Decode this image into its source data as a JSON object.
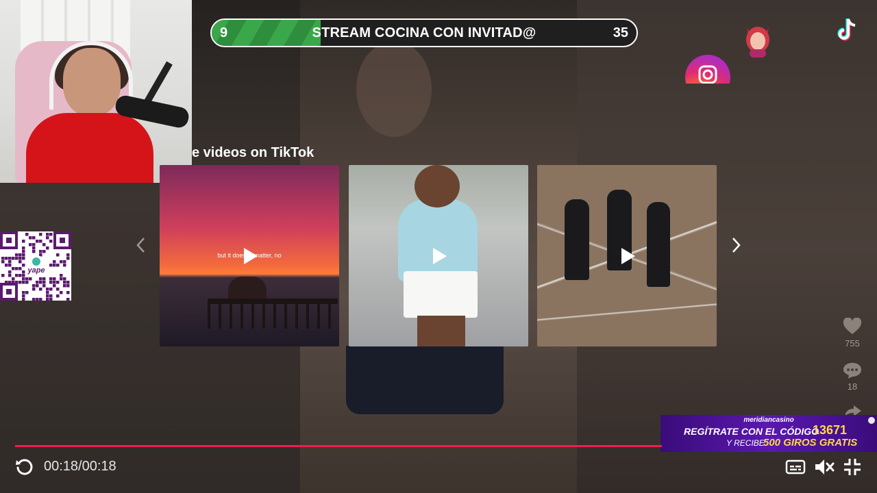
{
  "stream_goal": {
    "current": "9",
    "title": "STREAM COCINA CON INVITAD@",
    "target": "35",
    "progress_fraction": 0.257
  },
  "tiktok_panel": {
    "heading": "e videos on TikTok",
    "videos": [
      {
        "caption": "but it doesn't matter, no",
        "thumbnail": "sunset-pier"
      },
      {
        "caption": "",
        "thumbnail": "toddler-walking"
      },
      {
        "caption": "",
        "thumbnail": "dancers-court"
      }
    ]
  },
  "stats": {
    "likes": "755",
    "comments": "18"
  },
  "casino_banner": {
    "brand": "meridiancasino",
    "line1": "REGÍTRATE CON EL CÓDIGO",
    "code": "13671",
    "line2": "Y RECIBE",
    "bonus": "500 GIROS GRATIS"
  },
  "player": {
    "time": "00:18/00:18"
  },
  "qr_label": "yape",
  "colors": {
    "progress_green": "#3aa84a",
    "timeline_red": "#ee1d52",
    "casino_purple": "#4a12a0",
    "casino_yellow": "#ffd84a"
  }
}
